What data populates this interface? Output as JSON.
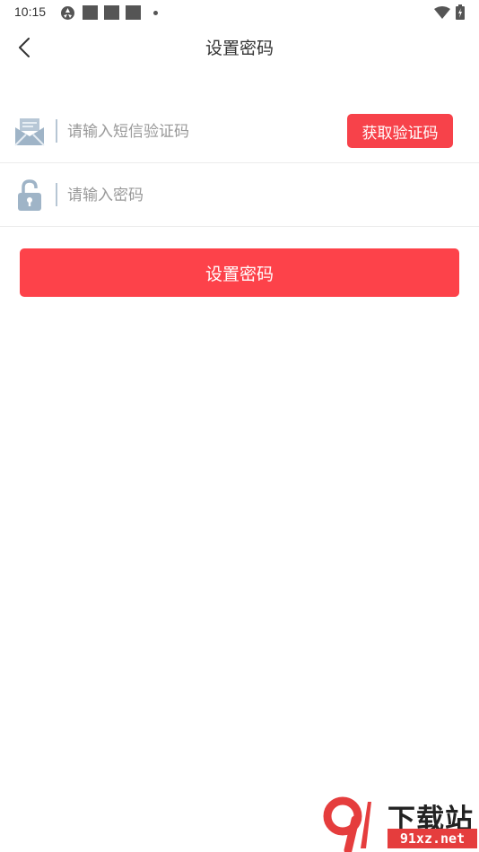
{
  "status_bar": {
    "time": "10:15"
  },
  "header": {
    "title": "设置密码",
    "back_icon": "chevron-left-icon"
  },
  "form": {
    "sms_row": {
      "icon": "envelope-icon",
      "placeholder": "请输入短信验证码",
      "value": "",
      "code_button_label": "获取验证码"
    },
    "password_row": {
      "icon": "lock-icon",
      "placeholder": "请输入密码",
      "value": ""
    },
    "submit_label": "设置密码"
  },
  "watermark": {
    "title": "下载站",
    "domain": "91xz.net"
  },
  "colors": {
    "accent": "#fd424a",
    "icon_blue": "#9fb4c7"
  }
}
